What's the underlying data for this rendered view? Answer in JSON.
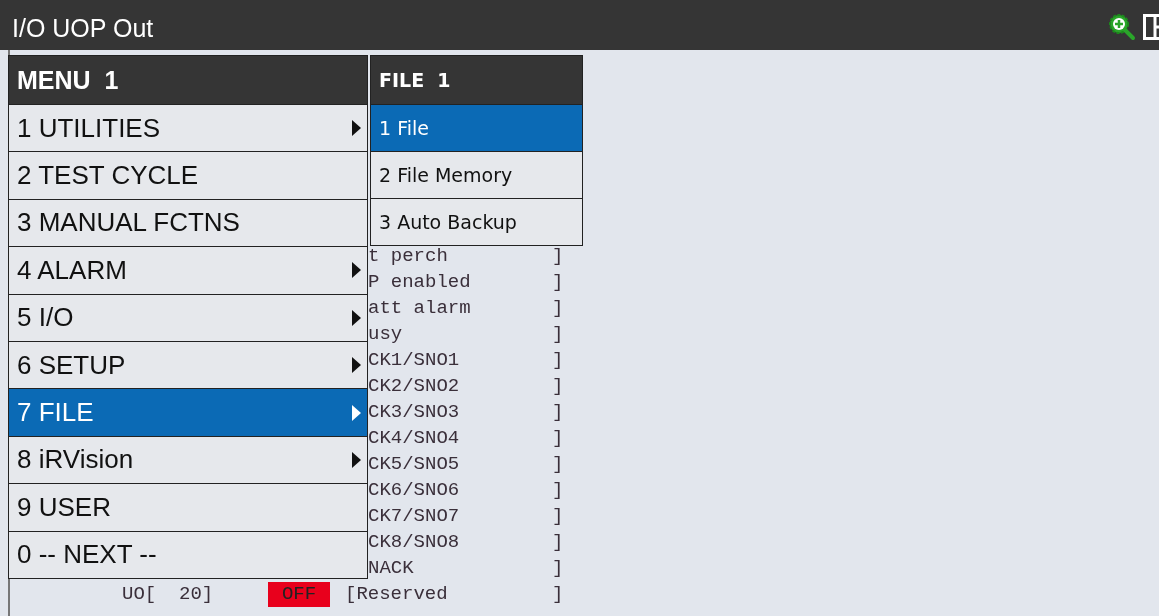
{
  "window": {
    "title": "I/O UOP Out"
  },
  "listing": [
    {
      "kind": "partial",
      "comment": "t perch",
      "bracket": "]"
    },
    {
      "kind": "partial",
      "comment": "P enabled",
      "bracket": "]"
    },
    {
      "kind": "partial",
      "comment": "att alarm",
      "bracket": "]"
    },
    {
      "kind": "partial",
      "comment": "usy",
      "bracket": "]"
    },
    {
      "kind": "partial",
      "comment": "CK1/SNO1",
      "bracket": "]"
    },
    {
      "kind": "partial",
      "comment": "CK2/SNO2",
      "bracket": "]"
    },
    {
      "kind": "partial",
      "comment": "CK3/SNO3",
      "bracket": "]"
    },
    {
      "kind": "partial",
      "comment": "CK4/SNO4",
      "bracket": "]"
    },
    {
      "kind": "partial",
      "comment": "CK5/SNO5",
      "bracket": "]"
    },
    {
      "kind": "partial",
      "comment": "CK6/SNO6",
      "bracket": "]"
    },
    {
      "kind": "partial",
      "comment": "CK7/SNO7",
      "bracket": "]"
    },
    {
      "kind": "partial",
      "comment": "CK8/SNO8",
      "bracket": "]"
    },
    {
      "kind": "partial",
      "comment": "NACK",
      "bracket": "]"
    },
    {
      "kind": "full",
      "label": "UO[  20]",
      "status": "OFF",
      "on": false,
      "comment": "[Reserved",
      "bracket": "]"
    }
  ],
  "menu": {
    "title": "MENU  1",
    "items": [
      {
        "label": "1 UTILITIES",
        "submenu": true,
        "selected": false
      },
      {
        "label": "2 TEST CYCLE",
        "submenu": false,
        "selected": false
      },
      {
        "label": "3 MANUAL FCTNS",
        "submenu": false,
        "selected": false
      },
      {
        "label": "4 ALARM",
        "submenu": true,
        "selected": false
      },
      {
        "label": "5 I/O",
        "submenu": true,
        "selected": false
      },
      {
        "label": "6 SETUP",
        "submenu": true,
        "selected": false
      },
      {
        "label": "7 FILE",
        "submenu": true,
        "selected": true
      },
      {
        "label": "8 iRVision",
        "submenu": true,
        "selected": false
      },
      {
        "label": "9 USER",
        "submenu": false,
        "selected": false
      },
      {
        "label": "0 -- NEXT --",
        "submenu": false,
        "selected": false
      }
    ]
  },
  "submenu": {
    "title": "FILE  1",
    "items": [
      {
        "label": "1 File",
        "selected": true
      },
      {
        "label": "2 File Memory",
        "selected": false
      },
      {
        "label": "3 Auto Backup",
        "selected": false
      }
    ]
  }
}
